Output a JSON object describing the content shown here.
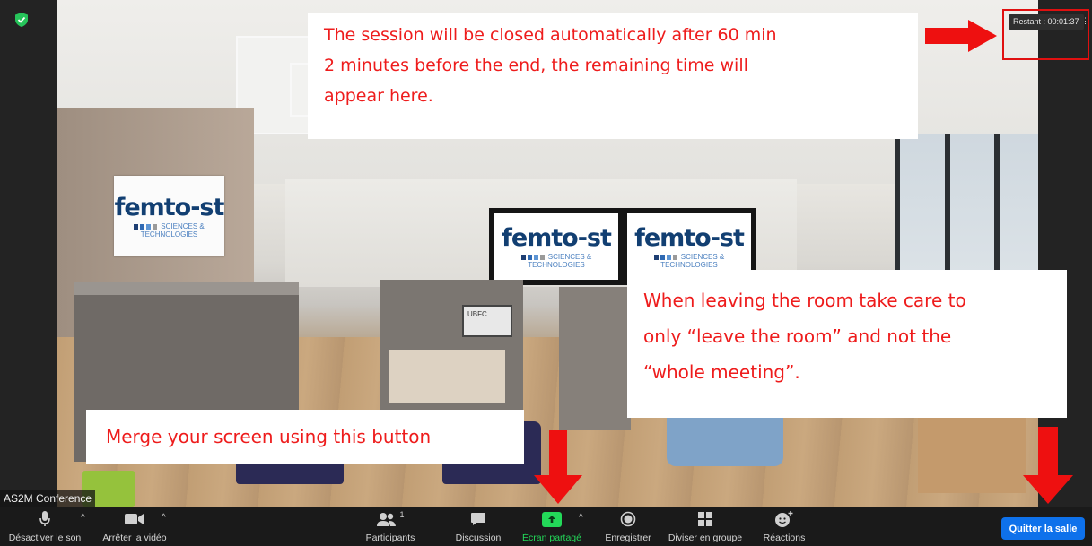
{
  "meeting": {
    "name_label": "AS2M Conference",
    "timer_text": "Restant : 00:01:37",
    "timer_more": "⋮"
  },
  "notes": {
    "session": "The session will be closed automatically after 60 min 2 minutes before the end, the remaining time will appear here.",
    "session_lines": [
      "The session will be closed automatically after 60 min",
      "2 minutes before the end, the remaining time will",
      "appear here."
    ],
    "leave_lines": [
      "When leaving the room take care to",
      "only “leave the room” and not the",
      "“whole meeting”."
    ],
    "merge": "Merge your screen using this button"
  },
  "background": {
    "logo_word": "femto-st",
    "logo_line1": "SCIENCES &",
    "logo_line2": "TECHNOLOGIES",
    "laptop_text": "UBFC",
    "logo_colors": [
      "#1e3f73",
      "#2f69b3",
      "#5d95d4",
      "#9a9a9a"
    ]
  },
  "toolbar": {
    "mute_label": "Désactiver le son",
    "video_label": "Arrêter la vidéo",
    "participants_label": "Participants",
    "participants_count": "1",
    "chat_label": "Discussion",
    "share_label": "Écran partagé",
    "record_label": "Enregistrer",
    "breakout_label": "Diviser en groupe",
    "reactions_label": "Réactions",
    "leave_label": "Quitter la salle"
  },
  "colors": {
    "accent_red": "#ee1c1c",
    "share_green": "#23d959",
    "leave_blue": "#0e71eb",
    "security_green": "#26c45a"
  }
}
